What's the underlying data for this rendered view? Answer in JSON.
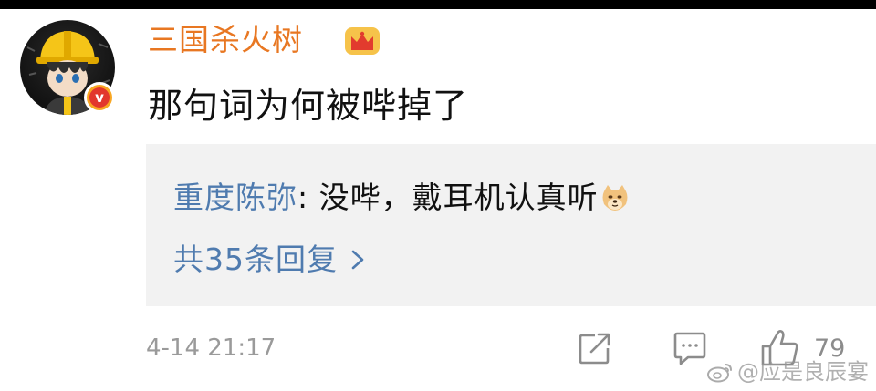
{
  "comment": {
    "username": "三国杀火树",
    "text": "那句词为何被哔掉了",
    "timestamp": "4-14 21:17",
    "like_count": "79",
    "verified_badge_letter": "v"
  },
  "reply_preview": {
    "author": "重度陈弥",
    "separator": ": ",
    "content": "没哔，戴耳机认真听",
    "emoji": "doge-emoji",
    "count_text": "共35条回复"
  },
  "watermark": {
    "text": "@应是良辰宴",
    "logo": "weibo-logo-icon"
  },
  "colors": {
    "username": "#e87722",
    "reply_link": "#4f7baf",
    "reply_bg": "#f2f2f2",
    "meta_gray": "#9a9a9a",
    "badge_orange": "#f8a723",
    "badge_red": "#e2372d"
  },
  "icons": {
    "crown": "crown-icon",
    "repost": "repost-icon",
    "comment": "comment-icon",
    "like": "like-icon",
    "chevron": "chevron-right-icon"
  }
}
